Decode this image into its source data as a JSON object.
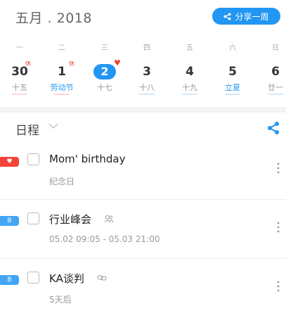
{
  "header": {
    "month_title": "五月 . 2018",
    "share_week_label": "分享一周"
  },
  "week": [
    {
      "weekday": "一",
      "date": "30",
      "lunar": "十五",
      "badge": "休",
      "selected": false,
      "festival": false
    },
    {
      "weekday": "二",
      "date": "1",
      "lunar": "劳动节",
      "badge": "休",
      "selected": false,
      "festival": true
    },
    {
      "weekday": "三",
      "date": "2",
      "lunar": "十七",
      "badge": "heart",
      "selected": true,
      "festival": false
    },
    {
      "weekday": "四",
      "date": "3",
      "lunar": "十八",
      "badge": "",
      "selected": false,
      "festival": false
    },
    {
      "weekday": "五",
      "date": "4",
      "lunar": "十九",
      "badge": "",
      "selected": false,
      "festival": false
    },
    {
      "weekday": "六",
      "date": "5",
      "lunar": "立夏",
      "badge": "",
      "selected": false,
      "festival": true
    },
    {
      "weekday": "日",
      "date": "6",
      "lunar": "廿一",
      "badge": "",
      "selected": false,
      "festival": false
    }
  ],
  "schedule": {
    "title": "日程",
    "events": [
      {
        "tag": "heart",
        "tag_color": "#f44336",
        "title": "Mom' birthday",
        "subtitle": "纪念日",
        "icon": ""
      },
      {
        "tag": "B",
        "tag_color": "#42a5f5",
        "title": "行业峰会",
        "subtitle": "05.02 09:05 - 05.03 21:00",
        "icon": "people-icon"
      },
      {
        "tag": "B",
        "tag_color": "#42a5f5",
        "title": "KA谈判",
        "subtitle": "5天后",
        "icon": "link-icon"
      }
    ]
  },
  "colors": {
    "accent": "#2196f3",
    "holiday": "#f44336"
  }
}
